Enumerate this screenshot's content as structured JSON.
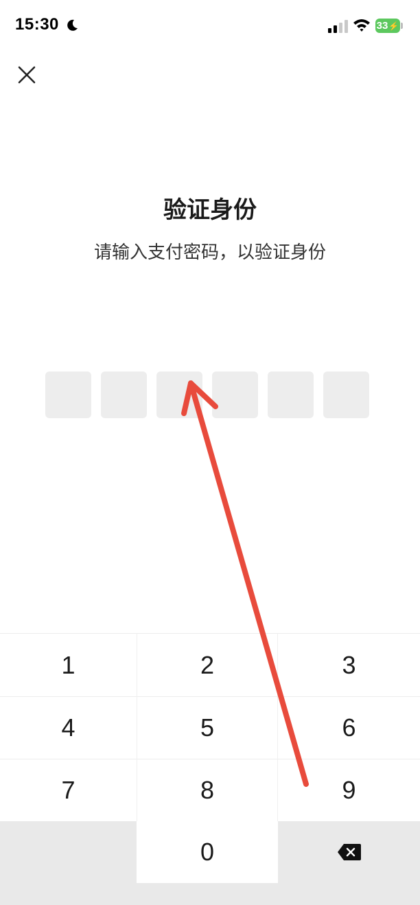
{
  "status_bar": {
    "time": "15:30",
    "battery_level": "33",
    "battery_color": "#5cc85e"
  },
  "header": {
    "close_icon": "close-icon"
  },
  "main": {
    "title": "验证身份",
    "subtitle": "请输入支付密码，以验证身份",
    "pin_length": 6
  },
  "keypad": {
    "keys": [
      "1",
      "2",
      "3",
      "4",
      "5",
      "6",
      "7",
      "8",
      "9",
      "0"
    ],
    "backspace_icon": "backspace-icon"
  },
  "annotation": {
    "arrow_color": "#e84b3c"
  }
}
